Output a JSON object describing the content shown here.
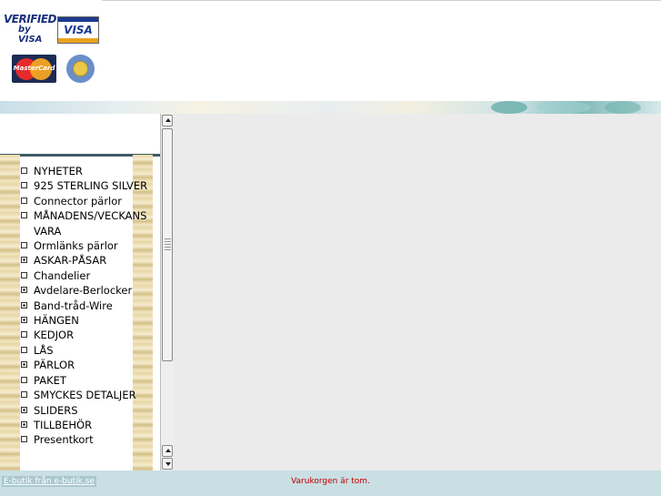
{
  "header": {
    "logos": [
      {
        "name": "verified-by-visa-logo",
        "line1": "VERIFIED",
        "line2": "by VISA"
      },
      {
        "name": "visa-logo",
        "text": "VISA"
      },
      {
        "name": "mastercard-logo",
        "text": "MasterCard"
      },
      {
        "name": "posten-logo"
      }
    ]
  },
  "menu": {
    "items": [
      {
        "label": "NYHETER",
        "expandable": false
      },
      {
        "label": "925 STERLING SILVER",
        "expandable": false
      },
      {
        "label": "Connector pärlor",
        "expandable": false
      },
      {
        "label": "MÅNADENS/VECKANS VARA",
        "expandable": false
      },
      {
        "label": "Ormlänks pärlor",
        "expandable": false
      },
      {
        "label": "ASKAR-PÅSAR",
        "expandable": true
      },
      {
        "label": "Chandelier",
        "expandable": false
      },
      {
        "label": "Avdelare-Berlocker",
        "expandable": true
      },
      {
        "label": "Band-tråd-Wire",
        "expandable": true
      },
      {
        "label": "HÄNGEN",
        "expandable": true
      },
      {
        "label": "KEDJOR",
        "expandable": false
      },
      {
        "label": "LÅS",
        "expandable": false
      },
      {
        "label": "PÄRLOR",
        "expandable": true
      },
      {
        "label": "PAKET",
        "expandable": false
      },
      {
        "label": "SMYCKES DETALJER",
        "expandable": false
      },
      {
        "label": "SLIDERS",
        "expandable": true
      },
      {
        "label": "TILLBEHÖR",
        "expandable": true
      },
      {
        "label": "Presentkort",
        "expandable": false
      }
    ]
  },
  "footer": {
    "link_text": "E-butik från e-butik.se",
    "cart_status": "Varukorgen är tom."
  },
  "colors": {
    "footer_bg": "#c9dfe3",
    "main_bg": "#ebebeb",
    "cart_status": "#c00000"
  }
}
